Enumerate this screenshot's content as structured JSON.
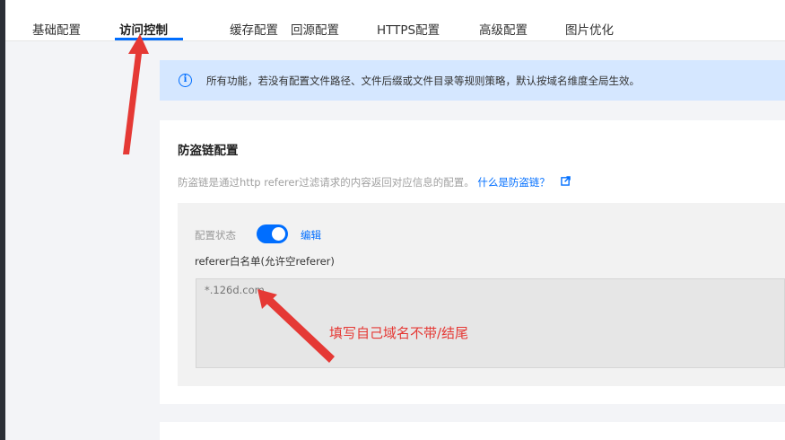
{
  "tabs": [
    {
      "label": "基础配置"
    },
    {
      "label": "访问控制",
      "active": true
    },
    {
      "label": "缓存配置"
    },
    {
      "label": "回源配置"
    },
    {
      "label": "HTTPS配置"
    },
    {
      "label": "高级配置"
    },
    {
      "label": "图片优化"
    }
  ],
  "notice": {
    "icon": "info-icon",
    "text": "所有功能，若没有配置文件路径、文件后缀或文件目录等规则策略，默认按域名维度全局生效。"
  },
  "hotlink": {
    "title": "防盗链配置",
    "description": "防盗链是通过http referer过滤请求的内容返回对应信息的配置。",
    "link_label": "什么是防盗链？",
    "status_label": "配置状态",
    "toggle_on": true,
    "edit_label": "编辑",
    "whitelist_label": "referer白名单(允许空referer)",
    "whitelist_placeholder": "*.126d.com"
  },
  "annotation": {
    "text": "填写自己域名不带/结尾",
    "color": "#e53935"
  },
  "colors": {
    "accent": "#006eff",
    "notice_bg": "#d5e7ff",
    "annotation": "#e53935"
  }
}
